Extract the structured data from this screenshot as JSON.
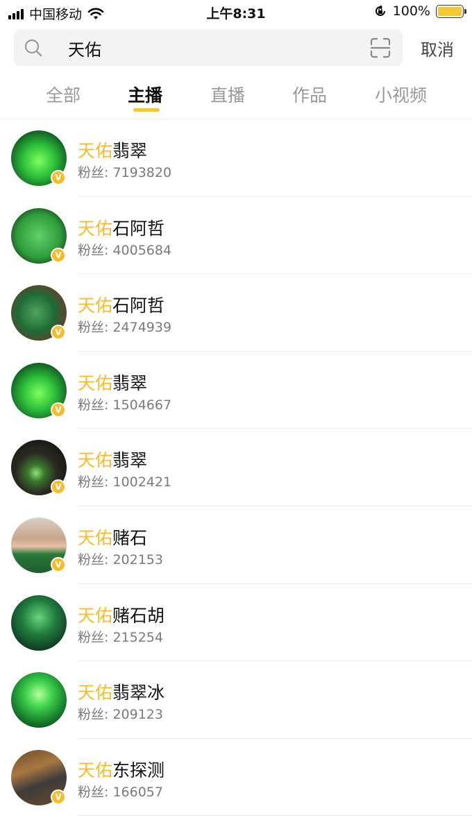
{
  "status_bar": {
    "carrier": "中国移动",
    "time": "上午8:31",
    "battery_percent_text": "100%",
    "battery_level": 1.0,
    "icons": [
      "signal-icon",
      "wifi-icon",
      "rotation-lock-icon",
      "battery-icon"
    ]
  },
  "search": {
    "query": "天佑",
    "cancel_label": "取消",
    "icons": [
      "search-icon",
      "scan-icon"
    ]
  },
  "tabs": [
    {
      "label": "全部",
      "active": false
    },
    {
      "label": "主播",
      "active": true
    },
    {
      "label": "直播",
      "active": false
    },
    {
      "label": "作品",
      "active": false
    },
    {
      "label": "小视频",
      "active": false
    }
  ],
  "colors": {
    "accent": "#f6bc2b",
    "tab_underline": "#f7c833",
    "secondary_text": "#7a7a7a",
    "inactive_tab": "#999999"
  },
  "results": [
    {
      "highlight": "天佑",
      "rest": "翡翠",
      "fans": "粉丝: 7193820",
      "verified": true,
      "avatar": "jade-glow"
    },
    {
      "highlight": "天佑",
      "rest": "石阿哲",
      "fans": "粉丝: 4005684",
      "verified": true,
      "avatar": "jade-slab"
    },
    {
      "highlight": "天佑",
      "rest": "石阿哲",
      "fans": "粉丝: 2474939",
      "verified": true,
      "avatar": "jade-rough"
    },
    {
      "highlight": "天佑",
      "rest": "翡翠",
      "fans": "粉丝: 1504667",
      "verified": true,
      "avatar": "jade-glow"
    },
    {
      "highlight": "天佑",
      "rest": "翡翠",
      "fans": "粉丝: 1002421",
      "verified": true,
      "avatar": "jade-dark"
    },
    {
      "highlight": "天佑",
      "rest": "赌石",
      "fans": "粉丝: 202153",
      "verified": true,
      "avatar": "person"
    },
    {
      "highlight": "天佑",
      "rest": "赌石胡",
      "fans": "粉丝: 215254",
      "verified": false,
      "avatar": "jade-cave"
    },
    {
      "highlight": "天佑",
      "rest": "翡翠冰",
      "fans": "粉丝: 209123",
      "verified": false,
      "avatar": "jade-bright"
    },
    {
      "highlight": "天佑",
      "rest": "东探测",
      "fans": "粉丝: 166057",
      "verified": true,
      "avatar": "detector"
    }
  ]
}
